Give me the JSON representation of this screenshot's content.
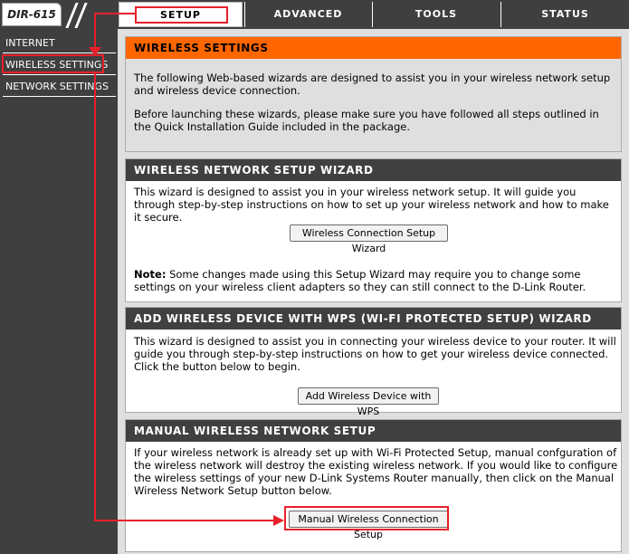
{
  "header": {
    "model": "DIR-615",
    "tabs": [
      {
        "label": "SETUP"
      },
      {
        "label": "ADVANCED"
      },
      {
        "label": "TOOLS"
      },
      {
        "label": "STATUS"
      }
    ]
  },
  "sidebar": {
    "items": [
      {
        "label": "INTERNET"
      },
      {
        "label": "WIRELESS SETTINGS"
      },
      {
        "label": "NETWORK SETTINGS"
      }
    ]
  },
  "intro": {
    "title": "WIRELESS SETTINGS",
    "p1": "The following Web-based wizards are designed to assist you in your wireless network setup and wireless device connection.",
    "p2": "Before launching these wizards, please make sure you have followed all steps outlined in the Quick Installation Guide included in the package."
  },
  "wizard": {
    "title": "WIRELESS NETWORK SETUP WIZARD",
    "text": "This wizard is designed to assist you in your wireless network setup. It will guide you through step-by-step instructions on how to set up your wireless network and how to make it secure.",
    "button": "Wireless Connection Setup Wizard",
    "note_label": "Note:",
    "note_text": " Some changes made using this Setup Wizard may require you to change some settings on your wireless client adapters so they can still connect to the D-Link Router."
  },
  "wps": {
    "title": "ADD WIRELESS DEVICE WITH WPS (WI-FI PROTECTED SETUP) WIZARD",
    "text": "This wizard is designed to assist you in connecting your wireless device to your router. It will guide you through step-by-step instructions on how to get your wireless device connected. Click the button below to begin.",
    "button": "Add Wireless Device with WPS"
  },
  "manual": {
    "title": "MANUAL WIRELESS NETWORK SETUP",
    "text": "If your wireless network is already set up with Wi-Fi Protected Setup, manual confguration of the wireless network will destroy the existing wireless network. If you would like to configure the wireless settings of your new D-Link Systems Router manually, then click on the Manual Wireless Network Setup button below.",
    "button": "Manual Wireless Connection Setup"
  },
  "colors": {
    "accent": "#ff6600",
    "highlight": "#e8202a",
    "dark": "#3f3f3f",
    "panel": "#dfdfdf"
  }
}
